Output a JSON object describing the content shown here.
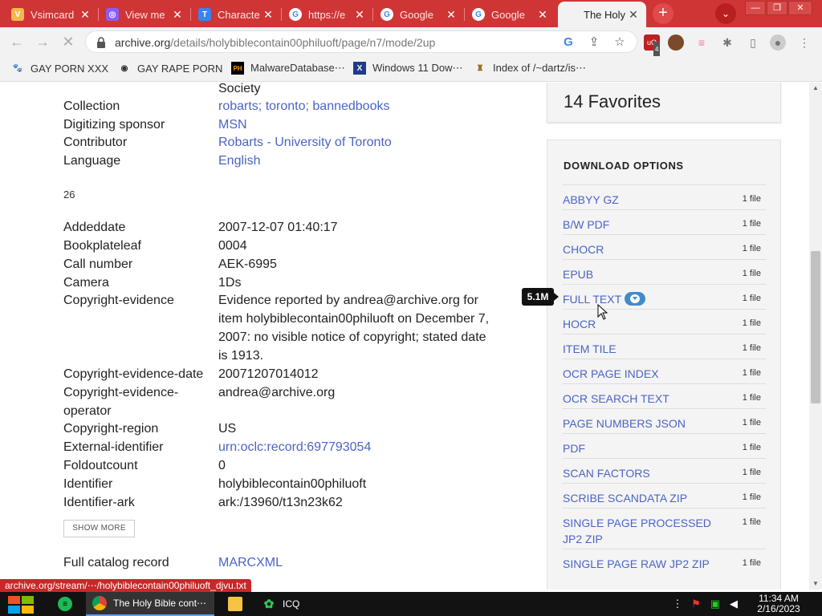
{
  "browser": {
    "tabs": [
      {
        "title": "Vsimcard",
        "favicon": "V",
        "favicon_color": "#f2b84b"
      },
      {
        "title": "View me",
        "favicon": "◎",
        "favicon_color": "#8b5cf6"
      },
      {
        "title": "Characte",
        "favicon": "T",
        "favicon_color": "#3b82f6"
      },
      {
        "title": "https://e",
        "favicon": "G",
        "favicon_color": "#ffffff"
      },
      {
        "title": "Google",
        "favicon": "G",
        "favicon_color": "#ffffff"
      },
      {
        "title": "Google",
        "favicon": "G",
        "favicon_color": "#ffffff"
      },
      {
        "title": "The Holy",
        "favicon": "",
        "favicon_color": "#f2f2f2"
      }
    ],
    "new_tab": "+",
    "tab_menu": "⌄",
    "url_main": "archive.org",
    "url_rest": "/details/holybiblecontain00philuoft/page/n7/mode/2up",
    "extension_badge": "4",
    "bookmarks": [
      {
        "label": "GAY PORN XXX",
        "icon": "🐾"
      },
      {
        "label": "GAY RAPE PORN",
        "icon": "◉"
      },
      {
        "label": "MalwareDatabase⋯",
        "icon": "PH"
      },
      {
        "label": "Windows 11 Dow⋯",
        "icon": "X"
      },
      {
        "label": "Index of /~dartz/is⋯",
        "icon": "♜"
      }
    ]
  },
  "metadata": {
    "top_partial": "Society",
    "rows_top": [
      {
        "key": "Collection",
        "value": "robarts; toronto; bannedbooks",
        "link": true
      },
      {
        "key": "Digitizing sponsor",
        "value": "MSN",
        "link": true
      },
      {
        "key": "Contributor",
        "value": "Robarts - University of Toronto",
        "link": true
      },
      {
        "key": "Language",
        "value": "English",
        "link": true
      }
    ],
    "count": "26",
    "rows": [
      {
        "key": "Addeddate",
        "value": "2007-12-07 01:40:17"
      },
      {
        "key": "Bookplateleaf",
        "value": "0004"
      },
      {
        "key": "Call number",
        "value": "AEK-6995"
      },
      {
        "key": "Camera",
        "value": "1Ds"
      },
      {
        "key": "Copyright-evidence",
        "value": "Evidence reported by andrea@archive.org for item holybiblecontain00philuoft on December 7, 2007: no visible notice of copyright; stated date is 1913."
      },
      {
        "key": "Copyright-evidence-date",
        "value": "20071207014012"
      },
      {
        "key": "Copyright-evidence-operator",
        "value": "andrea@archive.org"
      },
      {
        "key": "Copyright-region",
        "value": "US"
      },
      {
        "key": "External-identifier",
        "value": "urn:oclc:record:697793054",
        "link": true
      },
      {
        "key": "Foldoutcount",
        "value": "0"
      },
      {
        "key": "Identifier",
        "value": "holybiblecontain00philuoft"
      },
      {
        "key": "Identifier-ark",
        "value": "ark:/13960/t13n23k62"
      }
    ],
    "show_more": "SHOW MORE",
    "catalog_key": "Full catalog record",
    "catalog_value": "MARCXML"
  },
  "sidebar": {
    "favorites": "14 Favorites",
    "download_title": "DOWNLOAD OPTIONS",
    "tooltip": "5.1M",
    "downloads": [
      {
        "name": "ABBYY GZ",
        "count": "1 file"
      },
      {
        "name": "B/W PDF",
        "count": "1 file"
      },
      {
        "name": "CHOCR",
        "count": "1 file"
      },
      {
        "name": "EPUB",
        "count": "1 file"
      },
      {
        "name": "FULL TEXT",
        "count": "1 file"
      },
      {
        "name": "HOCR",
        "count": "1 file"
      },
      {
        "name": "ITEM TILE",
        "count": "1 file"
      },
      {
        "name": "OCR PAGE INDEX",
        "count": "1 file"
      },
      {
        "name": "OCR SEARCH TEXT",
        "count": "1 file"
      },
      {
        "name": "PAGE NUMBERS JSON",
        "count": "1 file"
      },
      {
        "name": "PDF",
        "count": "1 file"
      },
      {
        "name": "SCAN FACTORS",
        "count": "1 file"
      },
      {
        "name": "SCRIBE SCANDATA ZIP",
        "count": "1 file"
      },
      {
        "name": "SINGLE PAGE PROCESSED JP2 ZIP",
        "count": "1 file"
      },
      {
        "name": "SINGLE PAGE RAW JP2 ZIP",
        "count": "1 file"
      }
    ]
  },
  "status_url": "archive.org/stream/⋯/holybiblecontain00philuoft_djvu.txt",
  "taskbar": {
    "chrome_title": "The Holy Bible cont⋯",
    "icq_title": "ICQ",
    "time": "11:34 AM",
    "date": "2/16/2023"
  },
  "colors": {
    "accent_red": "#d03535",
    "link_blue": "#4b64c4",
    "download_badge": "#428bca"
  }
}
